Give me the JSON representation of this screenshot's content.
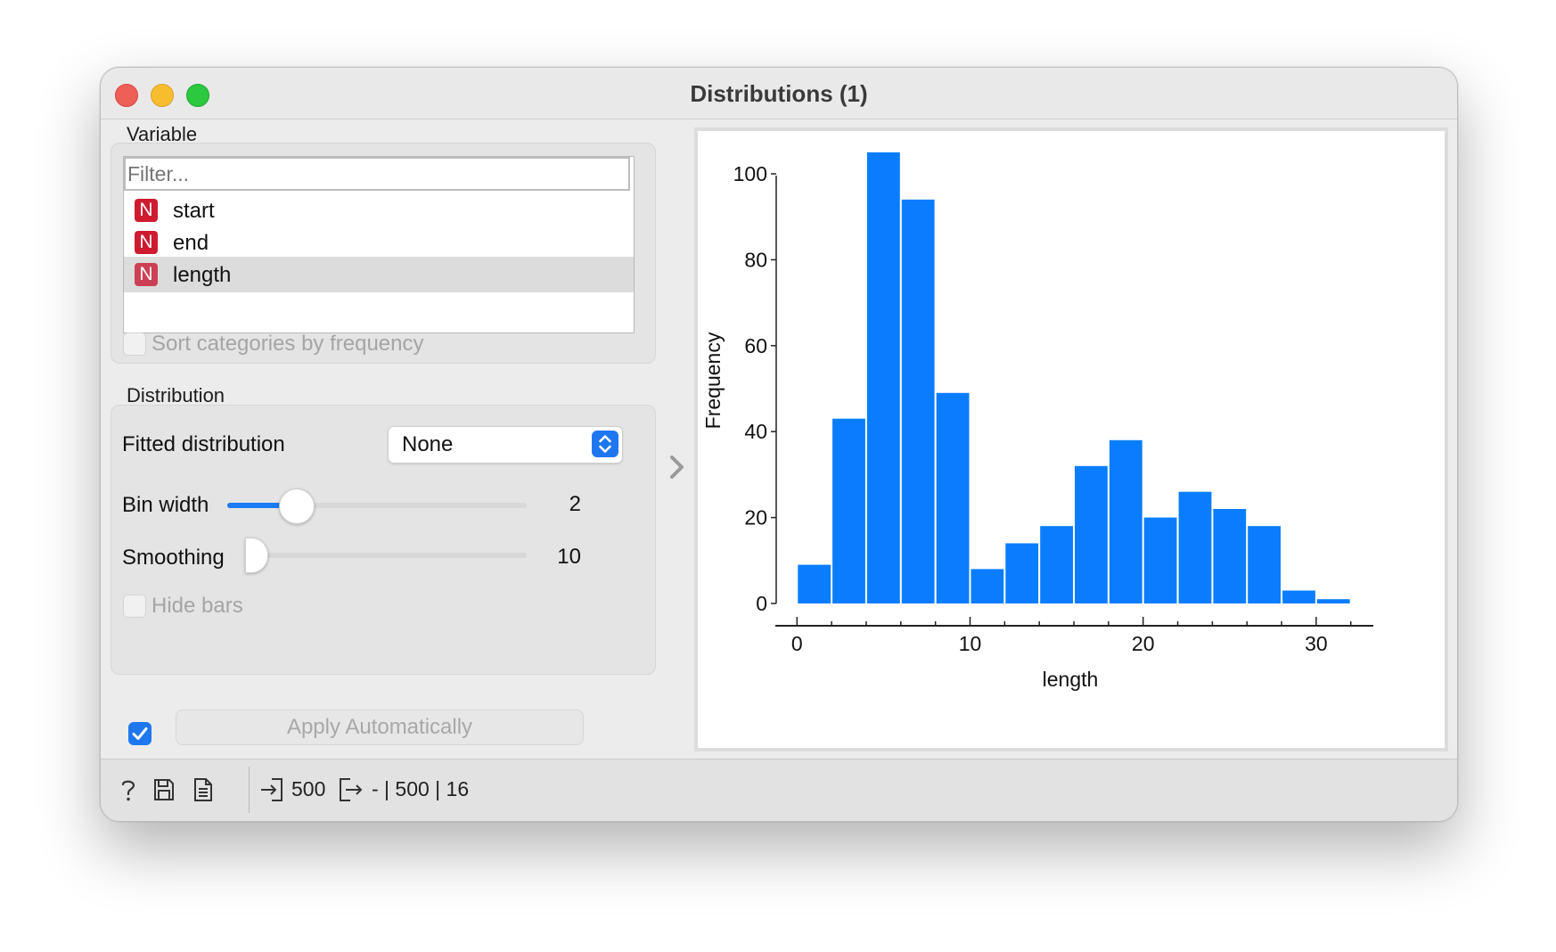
{
  "window": {
    "title": "Distributions (1)"
  },
  "variable_section": {
    "label": "Variable",
    "filter_placeholder": "Filter...",
    "items": [
      {
        "badge": "N",
        "label": "start"
      },
      {
        "badge": "N",
        "label": "end"
      },
      {
        "badge": "N",
        "label": "length",
        "selected": true
      }
    ],
    "sort_label": "Sort categories by frequency",
    "sort_checked": false
  },
  "distribution_section": {
    "label": "Distribution",
    "fitted_label": "Fitted distribution",
    "fitted_value": "None",
    "bin_width_label": "Bin width",
    "bin_width_value": "2",
    "bin_width_level": 0.23,
    "smoothing_label": "Smoothing",
    "smoothing_value": "10",
    "smoothing_level": 0.0,
    "hide_bars_label": "Hide bars",
    "hide_bars_checked": false
  },
  "apply": {
    "checked": true,
    "label": "Apply Automatically"
  },
  "status": {
    "input_count": "500",
    "output_text": "- | 500 | 16"
  },
  "colors": {
    "bar": "#0a7dff",
    "accent": "#1f77f0",
    "badge": "#cf1b30"
  },
  "icons": [
    "help-icon",
    "save-icon",
    "report-icon",
    "input-icon",
    "output-icon",
    "chevron-right-icon",
    "stepper-icon"
  ],
  "chart_data": {
    "type": "bar",
    "xlabel": "length",
    "ylabel": "Frequency",
    "bin_width": 2,
    "bins": [
      0,
      2,
      4,
      6,
      8,
      10,
      12,
      14,
      16,
      18,
      20,
      22,
      24,
      26,
      28,
      30
    ],
    "values": [
      9,
      43,
      105,
      94,
      49,
      8,
      14,
      18,
      32,
      38,
      20,
      26,
      22,
      18,
      3,
      1
    ],
    "xticks": [
      0,
      10,
      20,
      30
    ],
    "yticks": [
      0,
      20,
      40,
      60,
      80,
      100
    ],
    "xlim": [
      -1.2,
      33.3
    ],
    "ylim": [
      0,
      100
    ],
    "grid": false
  }
}
